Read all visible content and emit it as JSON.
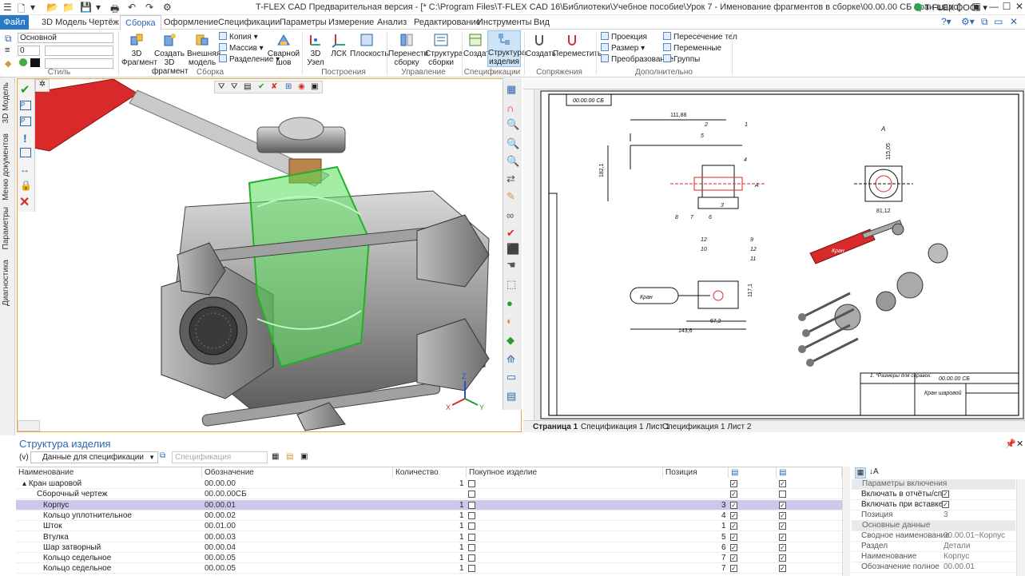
{
  "titlebar": {
    "title": "T-FLEX CAD Предварительная версия - [* C:\\Program Files\\T-FLEX CAD 16\\Библиотеки\\Учебное пособие\\Урок 7 - Именование фрагментов в сборке\\00.00.00 СБ Кран шаро]",
    "docs": "T-FLEX DOCs"
  },
  "menu": {
    "tabs": [
      "Файл",
      "3D Модель",
      "Чертёж",
      "Сборка",
      "Оформление",
      "Спецификации",
      "Параметры",
      "Измерение",
      "Анализ",
      "Редактирование",
      "Инструменты",
      "Вид"
    ]
  },
  "ribbon": {
    "style": {
      "layer": "Основной",
      "level": "0",
      "group_label": "Стиль"
    },
    "assembly": {
      "buttons": [
        "3D Фрагмент",
        "Создать 3D фрагмент",
        "Внешняя модель"
      ],
      "small": [
        "Копия",
        "Массив",
        "Разделение"
      ],
      "weld": "Сварной шов",
      "group_label": "Сборка"
    },
    "build": {
      "buttons": [
        "3D Узел",
        "ЛСК",
        "Плоскость"
      ],
      "group_label": "Построения"
    },
    "manage": {
      "buttons": [
        "Перенести сборку",
        "Структура сборки"
      ],
      "group_label": "Управление"
    },
    "specs": {
      "buttons": [
        "Создать",
        "Структура изделия"
      ],
      "group_label": "Спецификации"
    },
    "mates": {
      "buttons": [
        "Создать",
        "Переместить"
      ],
      "group_label": "Сопряжения"
    },
    "extra": {
      "left": [
        "Проекция",
        "Размер",
        "Преобразование"
      ],
      "right": [
        "Пересечение тел",
        "Переменные",
        "Группы"
      ],
      "group_label": "Дополнительно"
    }
  },
  "side": {
    "tabs": [
      "3D Модель",
      "Меню документов",
      "Параметры",
      "Диагностика"
    ]
  },
  "drawing": {
    "doc_code": "00.00.00 СБ",
    "stamp_code": "00.00.00 СБ",
    "stamp_name": "Кран шаровой",
    "view_a": "A",
    "dim_top": "111,88",
    "dim_left": "182,1",
    "dim_right": "115,05",
    "dim_side": "81,12",
    "dim_bottom": "67,2",
    "dim_bottom2": "143,6",
    "dim_side2": "117,1",
    "note": "1. *Размеры для справок.",
    "balloons": [
      "1",
      "2",
      "3",
      "4",
      "5",
      "6",
      "7",
      "8",
      "9",
      "10",
      "11",
      "12"
    ]
  },
  "pages": [
    "Страница 1",
    "Спецификация 1 Лист 1",
    "Спецификация 1 Лист 2"
  ],
  "panel": {
    "title": "Структура изделия",
    "filter": "Данные для спецификации",
    "spec_placeholder": "Спецификация"
  },
  "table": {
    "headers": [
      "Наименование",
      "Обозначение",
      "Количество",
      "Покупное изделие",
      "Позиция"
    ],
    "rows": [
      {
        "name": "Кран шаровой",
        "code": "00.00.00",
        "qty": "1",
        "pos": "",
        "buy": false,
        "c1": true,
        "c2": true
      },
      {
        "name": "Сборочный чертеж",
        "code": "00.00.00СБ",
        "qty": "",
        "pos": "",
        "buy": false,
        "c1": true,
        "c2": false
      },
      {
        "name": "Корпус",
        "code": "00.00.01",
        "qty": "1",
        "pos": "3",
        "buy": false,
        "c1": true,
        "c2": true
      },
      {
        "name": "Кольцо уплотнительное",
        "code": "00.00.02",
        "qty": "1",
        "pos": "4",
        "buy": false,
        "c1": true,
        "c2": true
      },
      {
        "name": "Шток",
        "code": "00.01.00",
        "qty": "1",
        "pos": "1",
        "buy": false,
        "c1": true,
        "c2": true
      },
      {
        "name": "Втулка",
        "code": "00.00.03",
        "qty": "1",
        "pos": "5",
        "buy": false,
        "c1": true,
        "c2": true
      },
      {
        "name": "Шар затворный",
        "code": "00.00.04",
        "qty": "1",
        "pos": "6",
        "buy": false,
        "c1": true,
        "c2": true
      },
      {
        "name": "Кольцо седельное",
        "code": "00.00.05",
        "qty": "1",
        "pos": "7",
        "buy": false,
        "c1": true,
        "c2": true
      },
      {
        "name": "Кольцо седельное",
        "code": "00.00.05",
        "qty": "1",
        "pos": "7",
        "buy": false,
        "c1": true,
        "c2": true
      }
    ]
  },
  "props": {
    "sec1": "Параметры включения",
    "inc_report": "Включать в отчёты/сп",
    "inc_insert": "Включать при вставке",
    "pos_label": "Позиция",
    "pos_val": "3",
    "sec2": "Основные данные",
    "rows": [
      {
        "k": "Сводное наименование",
        "v": "00.00.01~Корпус"
      },
      {
        "k": "Раздел",
        "v": "Детали"
      },
      {
        "k": "Наименование",
        "v": "Корпус"
      },
      {
        "k": "Обозначение полное",
        "v": "00.00.01"
      }
    ]
  }
}
